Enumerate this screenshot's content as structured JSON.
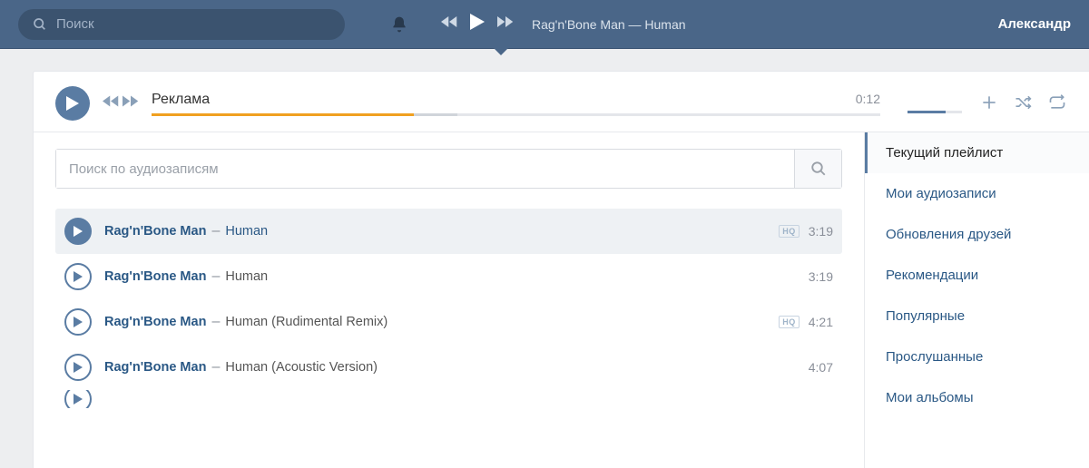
{
  "topbar": {
    "search_placeholder": "Поиск",
    "now_playing": "Rag'n'Bone Man — Human",
    "user_name": "Александр"
  },
  "player": {
    "title": "Реклама",
    "time": "0:12",
    "progress_pct": 36
  },
  "audio_search": {
    "placeholder": "Поиск по аудиозаписям"
  },
  "tracks": [
    {
      "artist": "Rag'n'Bone Man",
      "title": "Human",
      "duration": "3:19",
      "hq": true,
      "selected": true
    },
    {
      "artist": "Rag'n'Bone Man",
      "title": "Human",
      "duration": "3:19",
      "hq": false,
      "selected": false
    },
    {
      "artist": "Rag'n'Bone Man",
      "title": "Human (Rudimental Remix)",
      "duration": "4:21",
      "hq": true,
      "selected": false
    },
    {
      "artist": "Rag'n'Bone Man",
      "title": "Human (Acoustic Version)",
      "duration": "4:07",
      "hq": false,
      "selected": false
    }
  ],
  "sidebar": {
    "items": [
      {
        "label": "Текущий плейлист",
        "active": true
      },
      {
        "label": "Мои аудиозаписи",
        "active": false
      },
      {
        "label": "Обновления друзей",
        "active": false
      },
      {
        "label": "Рекомендации",
        "active": false
      },
      {
        "label": "Популярные",
        "active": false
      },
      {
        "label": "Прослушанные",
        "active": false
      },
      {
        "label": "Мои альбомы",
        "active": false
      }
    ]
  }
}
